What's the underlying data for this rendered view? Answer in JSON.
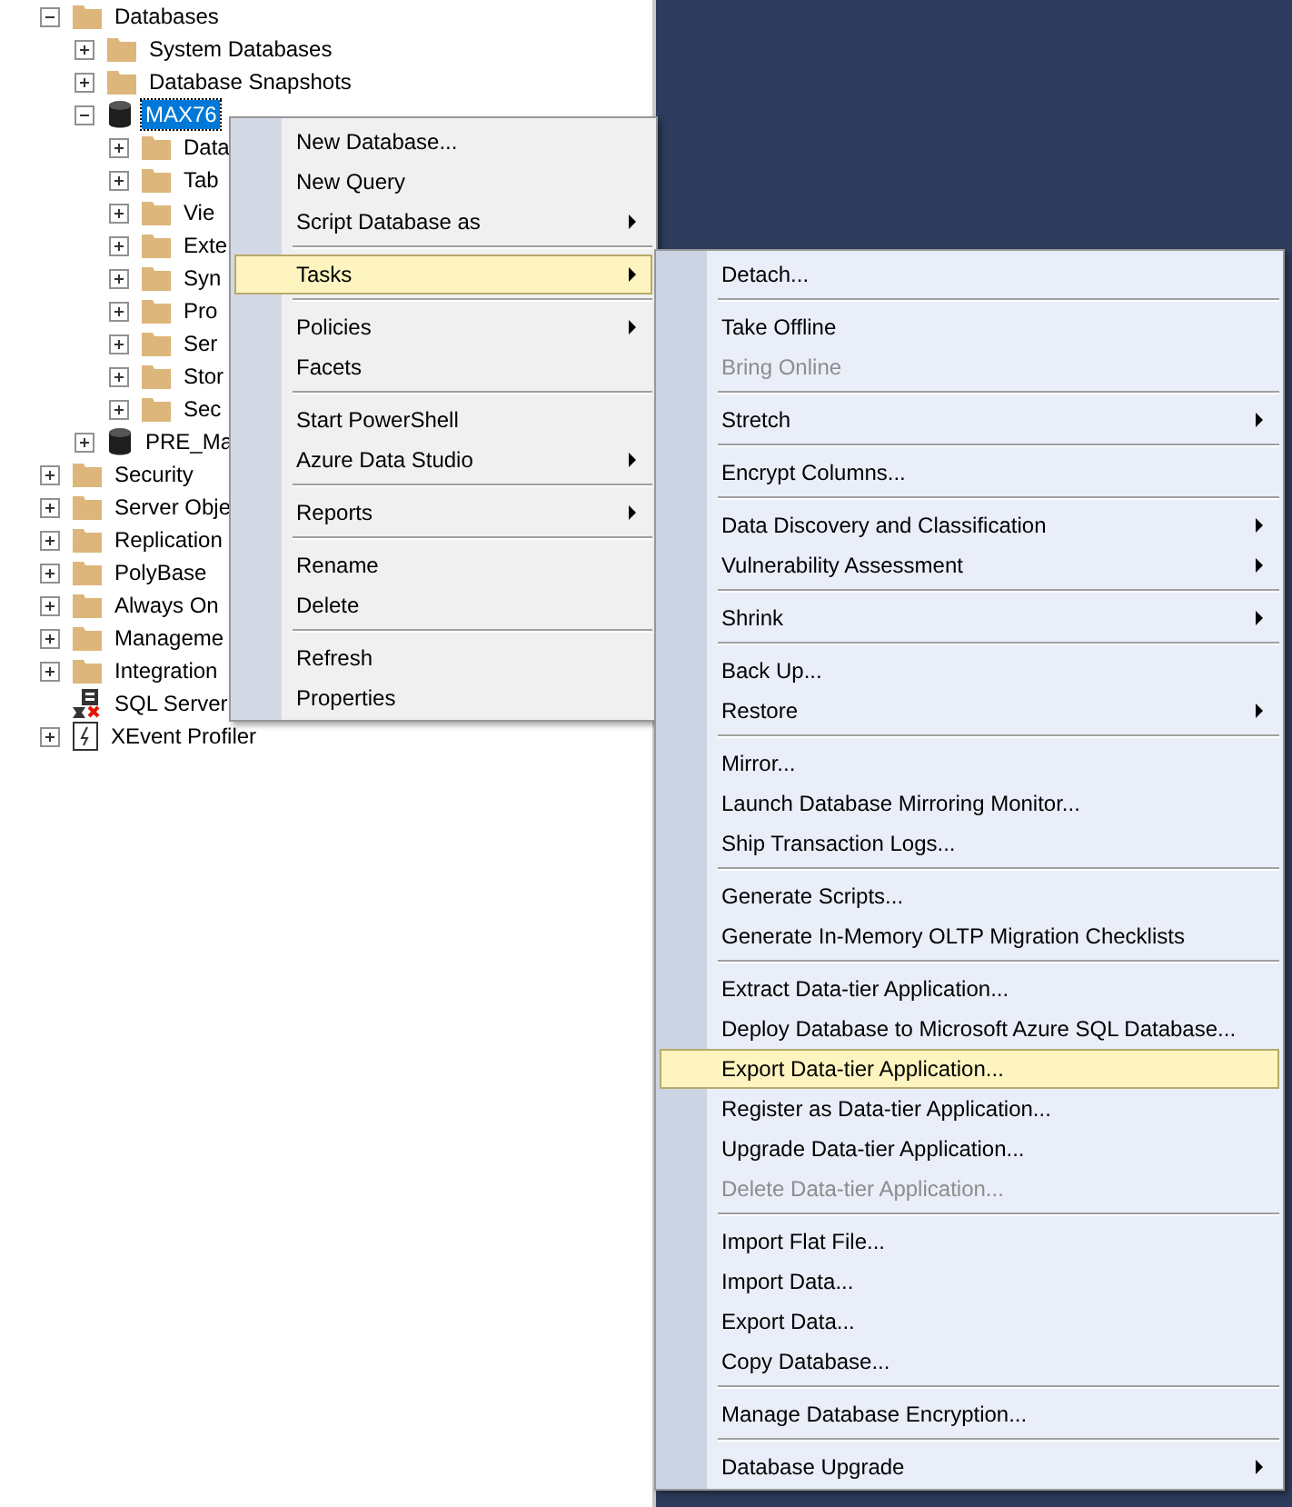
{
  "tree": [
    {
      "label": "Databases",
      "kind": "folder",
      "expanded": true,
      "selected": false,
      "children": [
        {
          "label": "System Databases",
          "kind": "folder",
          "expanded": false,
          "selected": false
        },
        {
          "label": "Database Snapshots",
          "kind": "folder",
          "expanded": false,
          "selected": false
        },
        {
          "label": "MAX76",
          "kind": "database",
          "expanded": true,
          "selected": true,
          "children": [
            {
              "label": "Data",
              "kind": "folder",
              "expanded": false,
              "selected": false
            },
            {
              "label": "Tab",
              "kind": "folder",
              "expanded": false,
              "selected": false
            },
            {
              "label": "Vie",
              "kind": "folder",
              "expanded": false,
              "selected": false
            },
            {
              "label": "Exte",
              "kind": "folder",
              "expanded": false,
              "selected": false
            },
            {
              "label": "Syn",
              "kind": "folder",
              "expanded": false,
              "selected": false
            },
            {
              "label": "Pro",
              "kind": "folder",
              "expanded": false,
              "selected": false
            },
            {
              "label": "Ser",
              "kind": "folder",
              "expanded": false,
              "selected": false
            },
            {
              "label": "Stor",
              "kind": "folder",
              "expanded": false,
              "selected": false
            },
            {
              "label": "Sec",
              "kind": "folder",
              "expanded": false,
              "selected": false
            }
          ]
        },
        {
          "label": "PRE_Ma",
          "kind": "database",
          "expanded": false,
          "selected": false
        }
      ]
    },
    {
      "label": "Security",
      "kind": "folder",
      "expanded": false,
      "selected": false
    },
    {
      "label": "Server Obje",
      "kind": "folder",
      "expanded": false,
      "selected": false
    },
    {
      "label": "Replication",
      "kind": "folder",
      "expanded": false,
      "selected": false
    },
    {
      "label": "PolyBase",
      "kind": "folder",
      "expanded": false,
      "selected": false
    },
    {
      "label": "Always On",
      "kind": "folder",
      "expanded": false,
      "selected": false
    },
    {
      "label": "Manageme",
      "kind": "folder",
      "expanded": false,
      "selected": false
    },
    {
      "label": "Integration",
      "kind": "folder",
      "expanded": false,
      "selected": false
    },
    {
      "label": "SQL Server",
      "kind": "agent",
      "selected": false
    },
    {
      "label": "XEvent Profiler",
      "kind": "xevent",
      "expanded": false,
      "selected": false
    }
  ],
  "context_menu": [
    {
      "kind": "item",
      "label": "New Database...",
      "submenu": false,
      "selected": false,
      "disabled": false
    },
    {
      "kind": "item",
      "label": "New Query",
      "submenu": false,
      "selected": false,
      "disabled": false
    },
    {
      "kind": "item",
      "label": "Script Database as",
      "submenu": true,
      "selected": false,
      "disabled": false
    },
    {
      "kind": "separator"
    },
    {
      "kind": "item",
      "label": "Tasks",
      "submenu": true,
      "selected": true,
      "disabled": false
    },
    {
      "kind": "separator"
    },
    {
      "kind": "item",
      "label": "Policies",
      "submenu": true,
      "selected": false,
      "disabled": false
    },
    {
      "kind": "item",
      "label": "Facets",
      "submenu": false,
      "selected": false,
      "disabled": false
    },
    {
      "kind": "separator"
    },
    {
      "kind": "item",
      "label": "Start PowerShell",
      "submenu": false,
      "selected": false,
      "disabled": false
    },
    {
      "kind": "item",
      "label": "Azure Data Studio",
      "submenu": true,
      "selected": false,
      "disabled": false
    },
    {
      "kind": "separator"
    },
    {
      "kind": "item",
      "label": "Reports",
      "submenu": true,
      "selected": false,
      "disabled": false
    },
    {
      "kind": "separator"
    },
    {
      "kind": "item",
      "label": "Rename",
      "submenu": false,
      "selected": false,
      "disabled": false
    },
    {
      "kind": "item",
      "label": "Delete",
      "submenu": false,
      "selected": false,
      "disabled": false
    },
    {
      "kind": "separator"
    },
    {
      "kind": "item",
      "label": "Refresh",
      "submenu": false,
      "selected": false,
      "disabled": false
    },
    {
      "kind": "item",
      "label": "Properties",
      "submenu": false,
      "selected": false,
      "disabled": false
    }
  ],
  "tasks_submenu": [
    {
      "kind": "item",
      "label": "Detach...",
      "submenu": false,
      "selected": false,
      "disabled": false
    },
    {
      "kind": "separator"
    },
    {
      "kind": "item",
      "label": "Take Offline",
      "submenu": false,
      "selected": false,
      "disabled": false
    },
    {
      "kind": "item",
      "label": "Bring Online",
      "submenu": false,
      "selected": false,
      "disabled": true
    },
    {
      "kind": "separator"
    },
    {
      "kind": "item",
      "label": "Stretch",
      "submenu": true,
      "selected": false,
      "disabled": false
    },
    {
      "kind": "separator"
    },
    {
      "kind": "item",
      "label": "Encrypt Columns...",
      "submenu": false,
      "selected": false,
      "disabled": false
    },
    {
      "kind": "separator"
    },
    {
      "kind": "item",
      "label": "Data Discovery and Classification",
      "submenu": true,
      "selected": false,
      "disabled": false
    },
    {
      "kind": "item",
      "label": "Vulnerability Assessment",
      "submenu": true,
      "selected": false,
      "disabled": false
    },
    {
      "kind": "separator"
    },
    {
      "kind": "item",
      "label": "Shrink",
      "submenu": true,
      "selected": false,
      "disabled": false
    },
    {
      "kind": "separator"
    },
    {
      "kind": "item",
      "label": "Back Up...",
      "submenu": false,
      "selected": false,
      "disabled": false
    },
    {
      "kind": "item",
      "label": "Restore",
      "submenu": true,
      "selected": false,
      "disabled": false
    },
    {
      "kind": "separator"
    },
    {
      "kind": "item",
      "label": "Mirror...",
      "submenu": false,
      "selected": false,
      "disabled": false
    },
    {
      "kind": "item",
      "label": "Launch Database Mirroring Monitor...",
      "submenu": false,
      "selected": false,
      "disabled": false
    },
    {
      "kind": "item",
      "label": "Ship Transaction Logs...",
      "submenu": false,
      "selected": false,
      "disabled": false
    },
    {
      "kind": "separator"
    },
    {
      "kind": "item",
      "label": "Generate Scripts...",
      "submenu": false,
      "selected": false,
      "disabled": false
    },
    {
      "kind": "item",
      "label": "Generate In-Memory OLTP Migration Checklists",
      "submenu": false,
      "selected": false,
      "disabled": false
    },
    {
      "kind": "separator"
    },
    {
      "kind": "item",
      "label": "Extract Data-tier Application...",
      "submenu": false,
      "selected": false,
      "disabled": false
    },
    {
      "kind": "item",
      "label": "Deploy Database to Microsoft Azure SQL Database...",
      "submenu": false,
      "selected": false,
      "disabled": false
    },
    {
      "kind": "item",
      "label": "Export Data-tier Application...",
      "submenu": false,
      "selected": true,
      "disabled": false
    },
    {
      "kind": "item",
      "label": "Register as Data-tier Application...",
      "submenu": false,
      "selected": false,
      "disabled": false
    },
    {
      "kind": "item",
      "label": "Upgrade Data-tier Application...",
      "submenu": false,
      "selected": false,
      "disabled": false
    },
    {
      "kind": "item",
      "label": "Delete Data-tier Application...",
      "submenu": false,
      "selected": false,
      "disabled": true
    },
    {
      "kind": "separator"
    },
    {
      "kind": "item",
      "label": "Import Flat File...",
      "submenu": false,
      "selected": false,
      "disabled": false
    },
    {
      "kind": "item",
      "label": "Import Data...",
      "submenu": false,
      "selected": false,
      "disabled": false
    },
    {
      "kind": "item",
      "label": "Export Data...",
      "submenu": false,
      "selected": false,
      "disabled": false
    },
    {
      "kind": "item",
      "label": "Copy Database...",
      "submenu": false,
      "selected": false,
      "disabled": false
    },
    {
      "kind": "separator"
    },
    {
      "kind": "item",
      "label": "Manage Database Encryption...",
      "submenu": false,
      "selected": false,
      "disabled": false
    },
    {
      "kind": "separator"
    },
    {
      "kind": "item",
      "label": "Database Upgrade",
      "submenu": true,
      "selected": false,
      "disabled": false
    }
  ]
}
